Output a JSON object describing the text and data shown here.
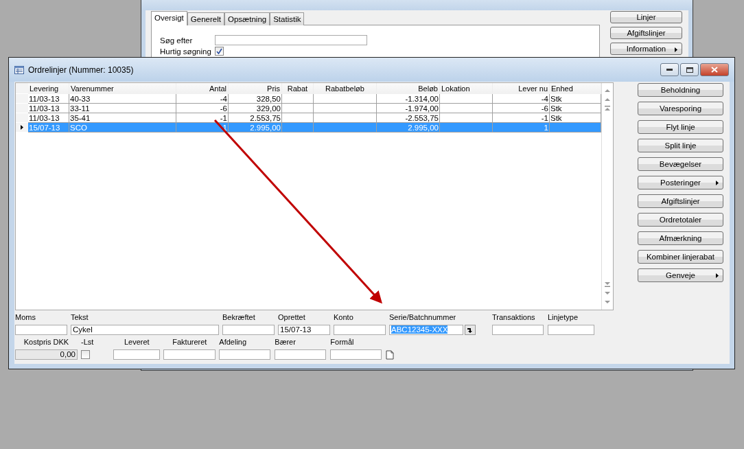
{
  "back_window": {
    "tabs": [
      {
        "label": "Oversigt",
        "selected": true
      },
      {
        "label": "Generelt",
        "selected": false
      },
      {
        "label": "Opsætning",
        "selected": false
      },
      {
        "label": "Statistik",
        "selected": false
      }
    ],
    "fields": [
      {
        "kind": "text",
        "label": "Søg efter"
      },
      {
        "kind": "check",
        "label": "Hurtig søgning",
        "checked": true
      }
    ],
    "buttons": [
      {
        "label": "Linjer",
        "kind": "plain"
      },
      {
        "label": "Afgiftslinjer",
        "kind": "plain"
      },
      {
        "label": "Information",
        "kind": "menu"
      }
    ]
  },
  "window": {
    "title": "Ordrelinjer (Nummer: 10035)"
  },
  "table": {
    "columns": [
      "Levering",
      "Varenummer",
      "Antal",
      "Pris",
      "Rabat",
      "Rabatbeløb",
      "Beløb",
      "Lokation",
      "Lever nu",
      "Enhed"
    ],
    "rows": [
      {
        "selected": false,
        "cells": [
          "11/03-13",
          "40-33",
          "-4",
          "328,50",
          "",
          "",
          "-1.314,00",
          "",
          "-4",
          "Stk"
        ]
      },
      {
        "selected": false,
        "cells": [
          "11/03-13",
          "33-11",
          "-6",
          "329,00",
          "",
          "",
          "-1.974,00",
          "",
          "-6",
          "Stk"
        ]
      },
      {
        "selected": false,
        "cells": [
          "11/03-13",
          "35-41",
          "-1",
          "2.553,75",
          "",
          "",
          "-2.553,75",
          "",
          "-1",
          "Stk"
        ]
      },
      {
        "selected": true,
        "cells": [
          "15/07-13",
          "SCO",
          "1",
          "2.995,00",
          "",
          "",
          "2.995,00",
          "",
          "1",
          ""
        ]
      }
    ]
  },
  "side_buttons": [
    {
      "label": "Beholdning",
      "kind": "plain"
    },
    {
      "label": "Varesporing",
      "kind": "plain"
    },
    {
      "label": "Flyt linje",
      "kind": "plain"
    },
    {
      "label": "Split linje",
      "kind": "plain"
    },
    {
      "label": "Bevægelser",
      "kind": "plain"
    },
    {
      "label": "Posteringer",
      "kind": "menu"
    },
    {
      "label": "Afgiftslinjer",
      "kind": "plain"
    },
    {
      "label": "Ordretotaler",
      "kind": "plain"
    },
    {
      "label": "Afmærkning",
      "kind": "plain"
    },
    {
      "label": "Kombiner linjerabat",
      "kind": "plain"
    },
    {
      "label": "Genveje",
      "kind": "menu"
    }
  ],
  "form_row_1": [
    {
      "kind": "text",
      "label": "Moms"
    },
    {
      "kind": "text",
      "label": "Tekst",
      "value": "Cykel"
    },
    {
      "kind": "text",
      "label": "Bekræftet"
    },
    {
      "kind": "text",
      "label": "Oprettet",
      "value": "15/07-13"
    },
    {
      "kind": "text",
      "label": "Konto"
    },
    {
      "kind": "lookup",
      "label": "Serie/Batchnummer",
      "value": "ABC12345-XXX"
    },
    {
      "kind": "text",
      "label": "Transaktions"
    },
    {
      "kind": "text",
      "label": "Linjetype"
    }
  ],
  "form_row_2": [
    {
      "kind": "readonly",
      "label": "Kostpris DKK",
      "value": "0,00"
    },
    {
      "kind": "check",
      "label": "-Lst",
      "checked": false
    },
    {
      "kind": "text",
      "label": "Leveret"
    },
    {
      "kind": "text",
      "label": "Faktureret"
    },
    {
      "kind": "text",
      "label": "Afdeling"
    },
    {
      "kind": "text",
      "label": "Bærer"
    },
    {
      "kind": "text",
      "label": "Formål"
    },
    {
      "kind": "note"
    }
  ]
}
